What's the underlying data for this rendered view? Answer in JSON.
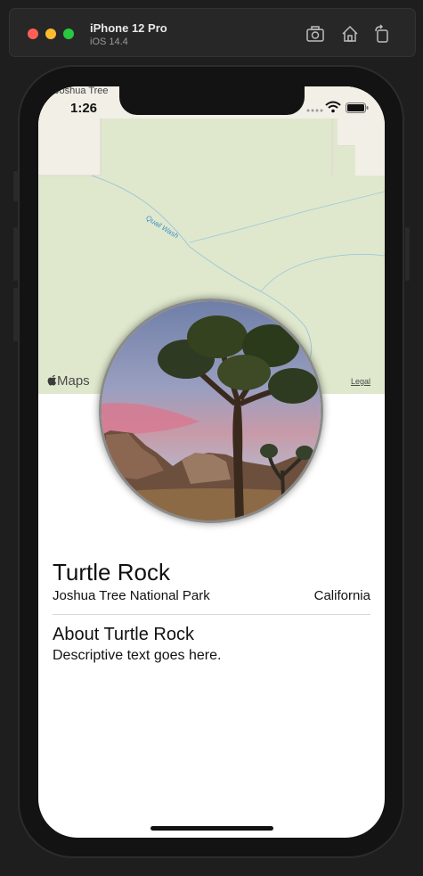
{
  "simulator": {
    "device_name": "iPhone 12 Pro",
    "os_version": "iOS 14.4"
  },
  "status_bar": {
    "time": "1:26"
  },
  "map": {
    "place_label": "Joshua Tree",
    "wash_label": "Quail Wash",
    "logo_text": "Maps",
    "legal_text": "Legal"
  },
  "landmark": {
    "name": "Turtle Rock",
    "park": "Joshua Tree National Park",
    "state": "California",
    "about_title": "About Turtle Rock",
    "description": "Descriptive text goes here."
  }
}
